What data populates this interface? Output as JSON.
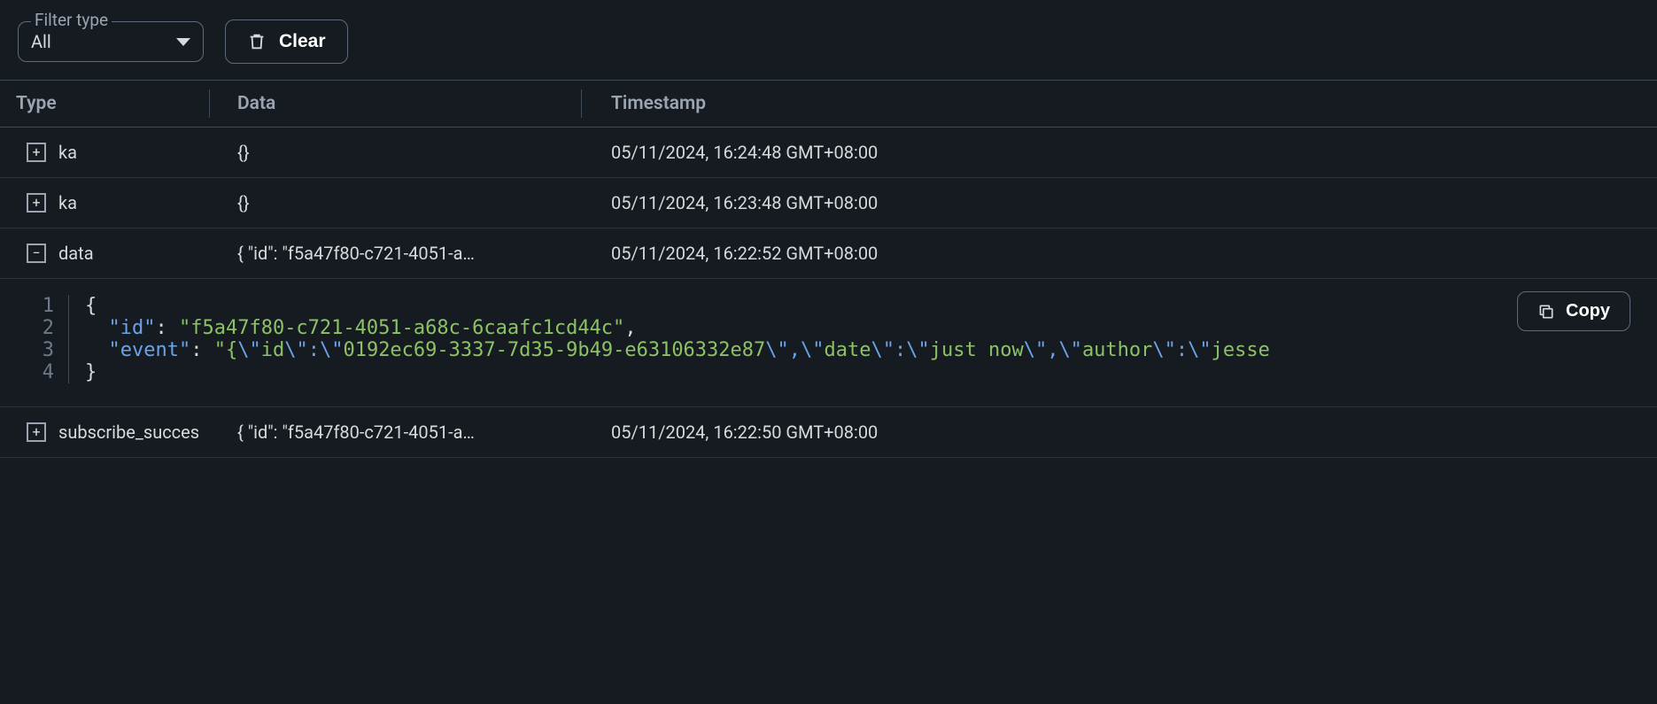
{
  "toolbar": {
    "filter_label": "Filter type",
    "filter_value": "All",
    "clear_label": "Clear"
  },
  "columns": {
    "type": "Type",
    "data": "Data",
    "timestamp": "Timestamp"
  },
  "rows": [
    {
      "expanded": false,
      "type": "ka",
      "data": "{}",
      "timestamp": "05/11/2024, 16:24:48 GMT+08:00"
    },
    {
      "expanded": false,
      "type": "ka",
      "data": "{}",
      "timestamp": "05/11/2024, 16:23:48 GMT+08:00"
    },
    {
      "expanded": true,
      "type": "data",
      "data": "{ \"id\": \"f5a47f80-c721-4051-a…",
      "timestamp": "05/11/2024, 16:22:52 GMT+08:00"
    },
    {
      "expanded": false,
      "type": "subscribe_succes",
      "data": "{ \"id\": \"f5a47f80-c721-4051-a…",
      "timestamp": "05/11/2024, 16:22:50 GMT+08:00"
    }
  ],
  "expanded_payload": {
    "id": "f5a47f80-c721-4051-a68c-6caafc1cd44c",
    "event": "{\"id\":\"0192ec69-3337-7d35-9b49-e63106332e87\",\"date\":\"just now\",\"author\":\"jesse"
  },
  "code_lines": {
    "l1": "{",
    "l2_key": "\"id\"",
    "l2_val": "\"f5a47f80-c721-4051-a68c-6caafc1cd44c\"",
    "l3_key": "\"event\"",
    "l3_seg1": "\"{",
    "l3_seg2": "\\\"",
    "l3_seg3": "id",
    "l3_seg4": "\\\":\\\"",
    "l3_seg5": "0192ec69-3337-7d35-9b49-e63106332e87",
    "l3_seg6": "\\\",\\\"",
    "l3_seg7": "date",
    "l3_seg8": "\\\":\\\"",
    "l3_seg9": "just now",
    "l3_seg10": "\\\",\\\"",
    "l3_seg11": "author",
    "l3_seg12": "\\\":\\\"",
    "l3_seg13": "jesse",
    "l4": "}"
  },
  "copy_label": "Copy",
  "line_numbers": {
    "n1": "1",
    "n2": "2",
    "n3": "3",
    "n4": "4"
  }
}
